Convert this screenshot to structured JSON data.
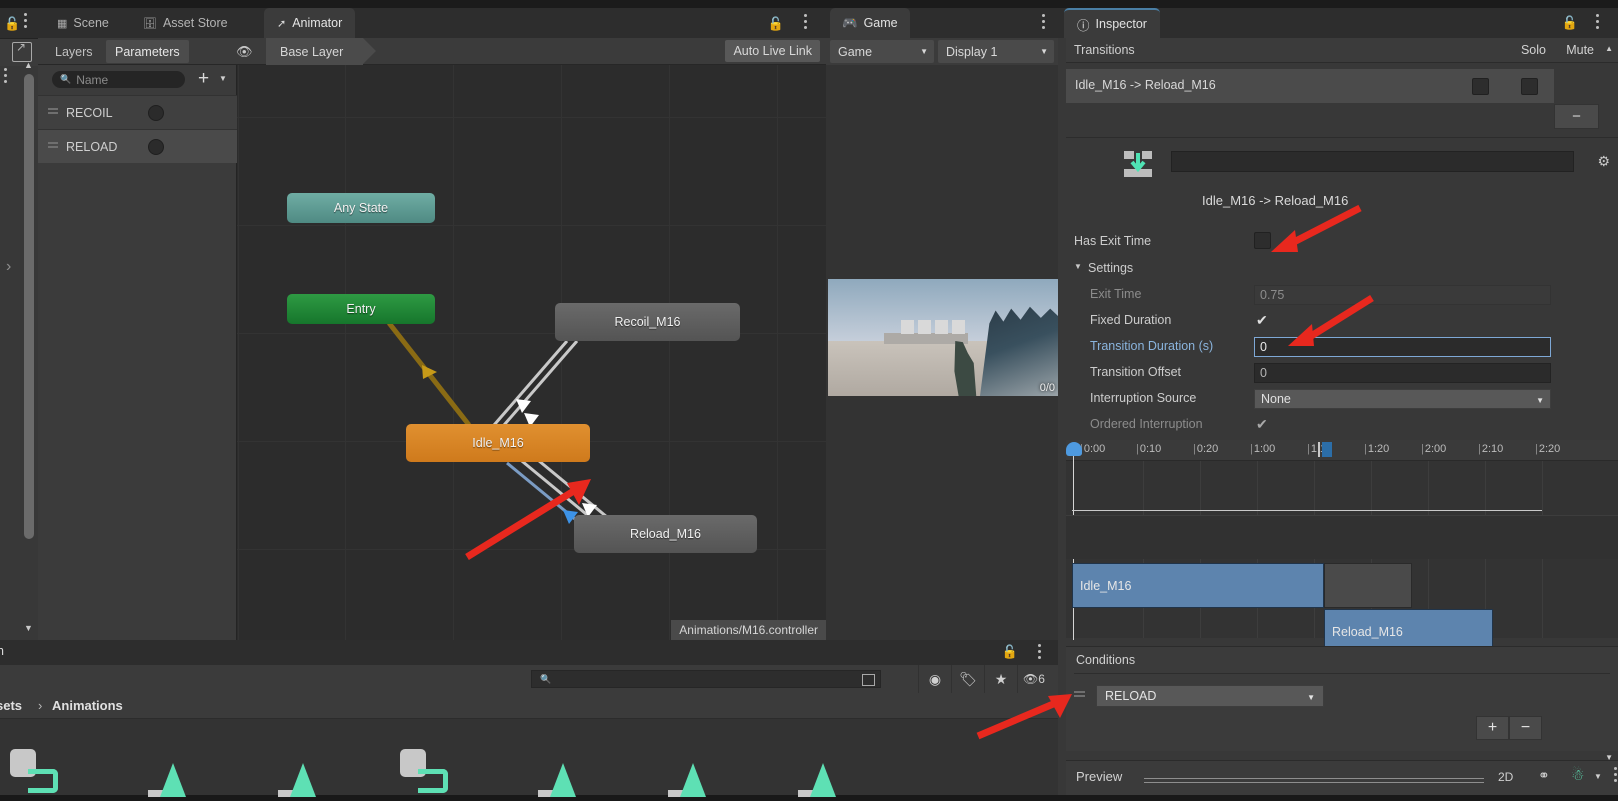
{
  "window_titles": {
    "animator_tabs": [
      {
        "label": "Scene",
        "icon": "grid-icon",
        "active": false
      },
      {
        "label": "Asset Store",
        "icon": "store-icon",
        "active": false
      },
      {
        "label": "Animator",
        "icon": "animator-icon",
        "active": true
      }
    ],
    "game_tab": {
      "label": "Game",
      "icon": "gamepad-icon"
    },
    "inspector_tab": {
      "label": "Inspector",
      "icon": "info-icon"
    }
  },
  "animator": {
    "layer_tabs": [
      {
        "label": "Layers",
        "selected": false
      },
      {
        "label": "Parameters",
        "selected": true
      }
    ],
    "eye_icon": "eye-icon",
    "base_layer": "Base Layer",
    "auto_live_link": "Auto Live Link",
    "parameters": {
      "search_placeholder": "Name",
      "add_label": "+",
      "items": [
        {
          "name": "RECOIL",
          "type": "trigger"
        },
        {
          "name": "RELOAD",
          "type": "trigger"
        }
      ]
    },
    "graph": {
      "nodes": [
        {
          "name": "Any State",
          "kind": "any-state"
        },
        {
          "name": "Entry",
          "kind": "entry"
        },
        {
          "name": "Idle_M16",
          "kind": "default-state"
        },
        {
          "name": "Recoil_M16",
          "kind": "state"
        },
        {
          "name": "Reload_M16",
          "kind": "state"
        }
      ],
      "controller_path": "Animations/M16.controller"
    }
  },
  "game": {
    "view_dropdown": "Game",
    "display_dropdown": "Display 1",
    "stats_counter": "0/0"
  },
  "inspector": {
    "transitions_header": "Transitions",
    "solo_label": "Solo",
    "mute_label": "Mute",
    "transition_list": [
      {
        "label": "Idle_M16 -> Reload_M16",
        "solo": false,
        "mute": false
      }
    ],
    "remove_button": "−",
    "asset_field_value": "",
    "asset_name": "Idle_M16 -> Reload_M16",
    "gear_icon": "gear-icon",
    "settings": {
      "has_exit_time_label": "Has Exit Time",
      "has_exit_time_value": false,
      "settings_label": "Settings",
      "fields": [
        {
          "label": "Exit Time",
          "value": "0.75",
          "kind": "text",
          "disabled": true
        },
        {
          "label": "Fixed Duration",
          "value": "✔",
          "kind": "check",
          "disabled": false
        },
        {
          "label": "Transition Duration (s)",
          "value": "0",
          "kind": "text-focused",
          "disabled": false
        },
        {
          "label": "Transition Offset",
          "value": "0",
          "kind": "text",
          "disabled": false
        },
        {
          "label": "Interruption Source",
          "value": "None",
          "kind": "dropdown",
          "disabled": false
        },
        {
          "label": "Ordered Interruption",
          "value": "✔",
          "kind": "check",
          "disabled": true
        }
      ]
    },
    "timeline": {
      "ticks": [
        "0:00",
        "0:10",
        "0:20",
        "1:00",
        "1:10",
        "1:20",
        "2:00",
        "2:10",
        "2:20"
      ],
      "clips": [
        {
          "name": "Idle_M16"
        },
        {
          "name": "Reload_M16"
        }
      ]
    },
    "conditions": {
      "title": "Conditions",
      "rows": [
        {
          "parameter": "RELOAD"
        }
      ],
      "add_label": "+",
      "remove_label": "−"
    },
    "preview": {
      "label": "Preview",
      "mode_2d": "2D",
      "bone_icon": "bone-icon",
      "avatar_icon": "avatar-icon"
    }
  },
  "project": {
    "tab_label": "on",
    "search_placeholder": "",
    "toolbar_icons": [
      "save-filter-icon",
      "label-icon",
      "star-icon",
      "hidden-eye-icon"
    ],
    "hidden_count": "6",
    "breadcrumb": [
      "sets",
      "Animations"
    ],
    "breadcrumb_separator": "›",
    "assets": [
      {
        "icon": "animator-controller-icon"
      },
      {
        "icon": "animation-clip-icon"
      },
      {
        "icon": "animation-clip-icon"
      },
      {
        "icon": "animator-controller-icon"
      },
      {
        "icon": "animation-clip-icon"
      },
      {
        "icon": "animation-clip-icon"
      },
      {
        "icon": "animation-clip-icon"
      }
    ]
  },
  "annotations": {
    "arrow_color": "#e8281e",
    "arrows": [
      {
        "target": "has-exit-time-checkbox"
      },
      {
        "target": "transition-duration-field"
      },
      {
        "target": "transition-arrow-marker"
      },
      {
        "target": "conditions-row"
      }
    ]
  }
}
